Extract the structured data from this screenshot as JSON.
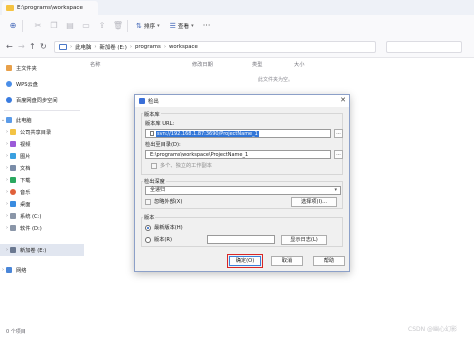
{
  "window": {
    "tab_title": "E:\\programs\\workspace"
  },
  "toolbar": {
    "sort_label": "排序",
    "view_label": "查看"
  },
  "address": {
    "crumbs": [
      "此电脑",
      "新加卷 (E:)",
      "programs",
      "workspace"
    ]
  },
  "sidebar": {
    "items": [
      {
        "label": "主文件夹",
        "icon": "home-icon",
        "chevron": false
      },
      {
        "label": "WPS云盘",
        "icon": "cloud-icon",
        "chevron": false
      },
      {
        "label": "百度网盘同步空间",
        "icon": "cloud-icon",
        "chevron": false
      },
      {
        "label": "此电脑",
        "icon": "computer-icon",
        "chevron": true
      },
      {
        "label": "公司共享目录",
        "icon": "folder-icon",
        "chevron": true
      },
      {
        "label": "视频",
        "icon": "video-icon",
        "chevron": true
      },
      {
        "label": "图片",
        "icon": "picture-icon",
        "chevron": true
      },
      {
        "label": "文档",
        "icon": "document-icon",
        "chevron": true
      },
      {
        "label": "下载",
        "icon": "download-icon",
        "chevron": true
      },
      {
        "label": "音乐",
        "icon": "music-icon",
        "chevron": true
      },
      {
        "label": "桌面",
        "icon": "desktop-icon",
        "chevron": true
      },
      {
        "label": "系统 (C:)",
        "icon": "drive-icon",
        "chevron": true
      },
      {
        "label": "软件 (D:)",
        "icon": "drive-icon",
        "chevron": true
      },
      {
        "label": "新加卷 (E:)",
        "icon": "drive-icon",
        "chevron": true,
        "selected": true
      },
      {
        "label": "网络",
        "icon": "network-icon",
        "chevron": true
      }
    ]
  },
  "columns": {
    "name": "名称",
    "modified": "修改日期",
    "type": "类型",
    "size": "大小"
  },
  "empty_message": "此文件夹为空。",
  "status": {
    "count": "0 个项目"
  },
  "watermark": "CSDN @幽心幻影",
  "dialog": {
    "title": "检出",
    "repo_group": "版本库",
    "repo_url_label": "版本库 URL:",
    "repo_url_value": "svn://192.168.1.87:3690/ProjectName_1",
    "checkout_dir_label": "检出至目录(D):",
    "checkout_dir_value": "E:\\programs\\workspace\\ProjectName_1",
    "multi_folder_label": "多个、独立的工作副本",
    "depth_group": "检出深度",
    "depth_value": "全递归",
    "omit_externals_label": "忽略外部(X)",
    "choose_items_label": "选择项(I)...",
    "revision_group": "版本",
    "head_revision_label": "最新版本(H)",
    "revision_label": "版本(R)",
    "show_log_label": "显示日志(L)",
    "ok_label": "确定(O)",
    "cancel_label": "取消",
    "help_label": "帮助",
    "browse_label": "..."
  },
  "colors": {
    "accent": "#3276d8",
    "highlight_outline": "#d92626"
  }
}
